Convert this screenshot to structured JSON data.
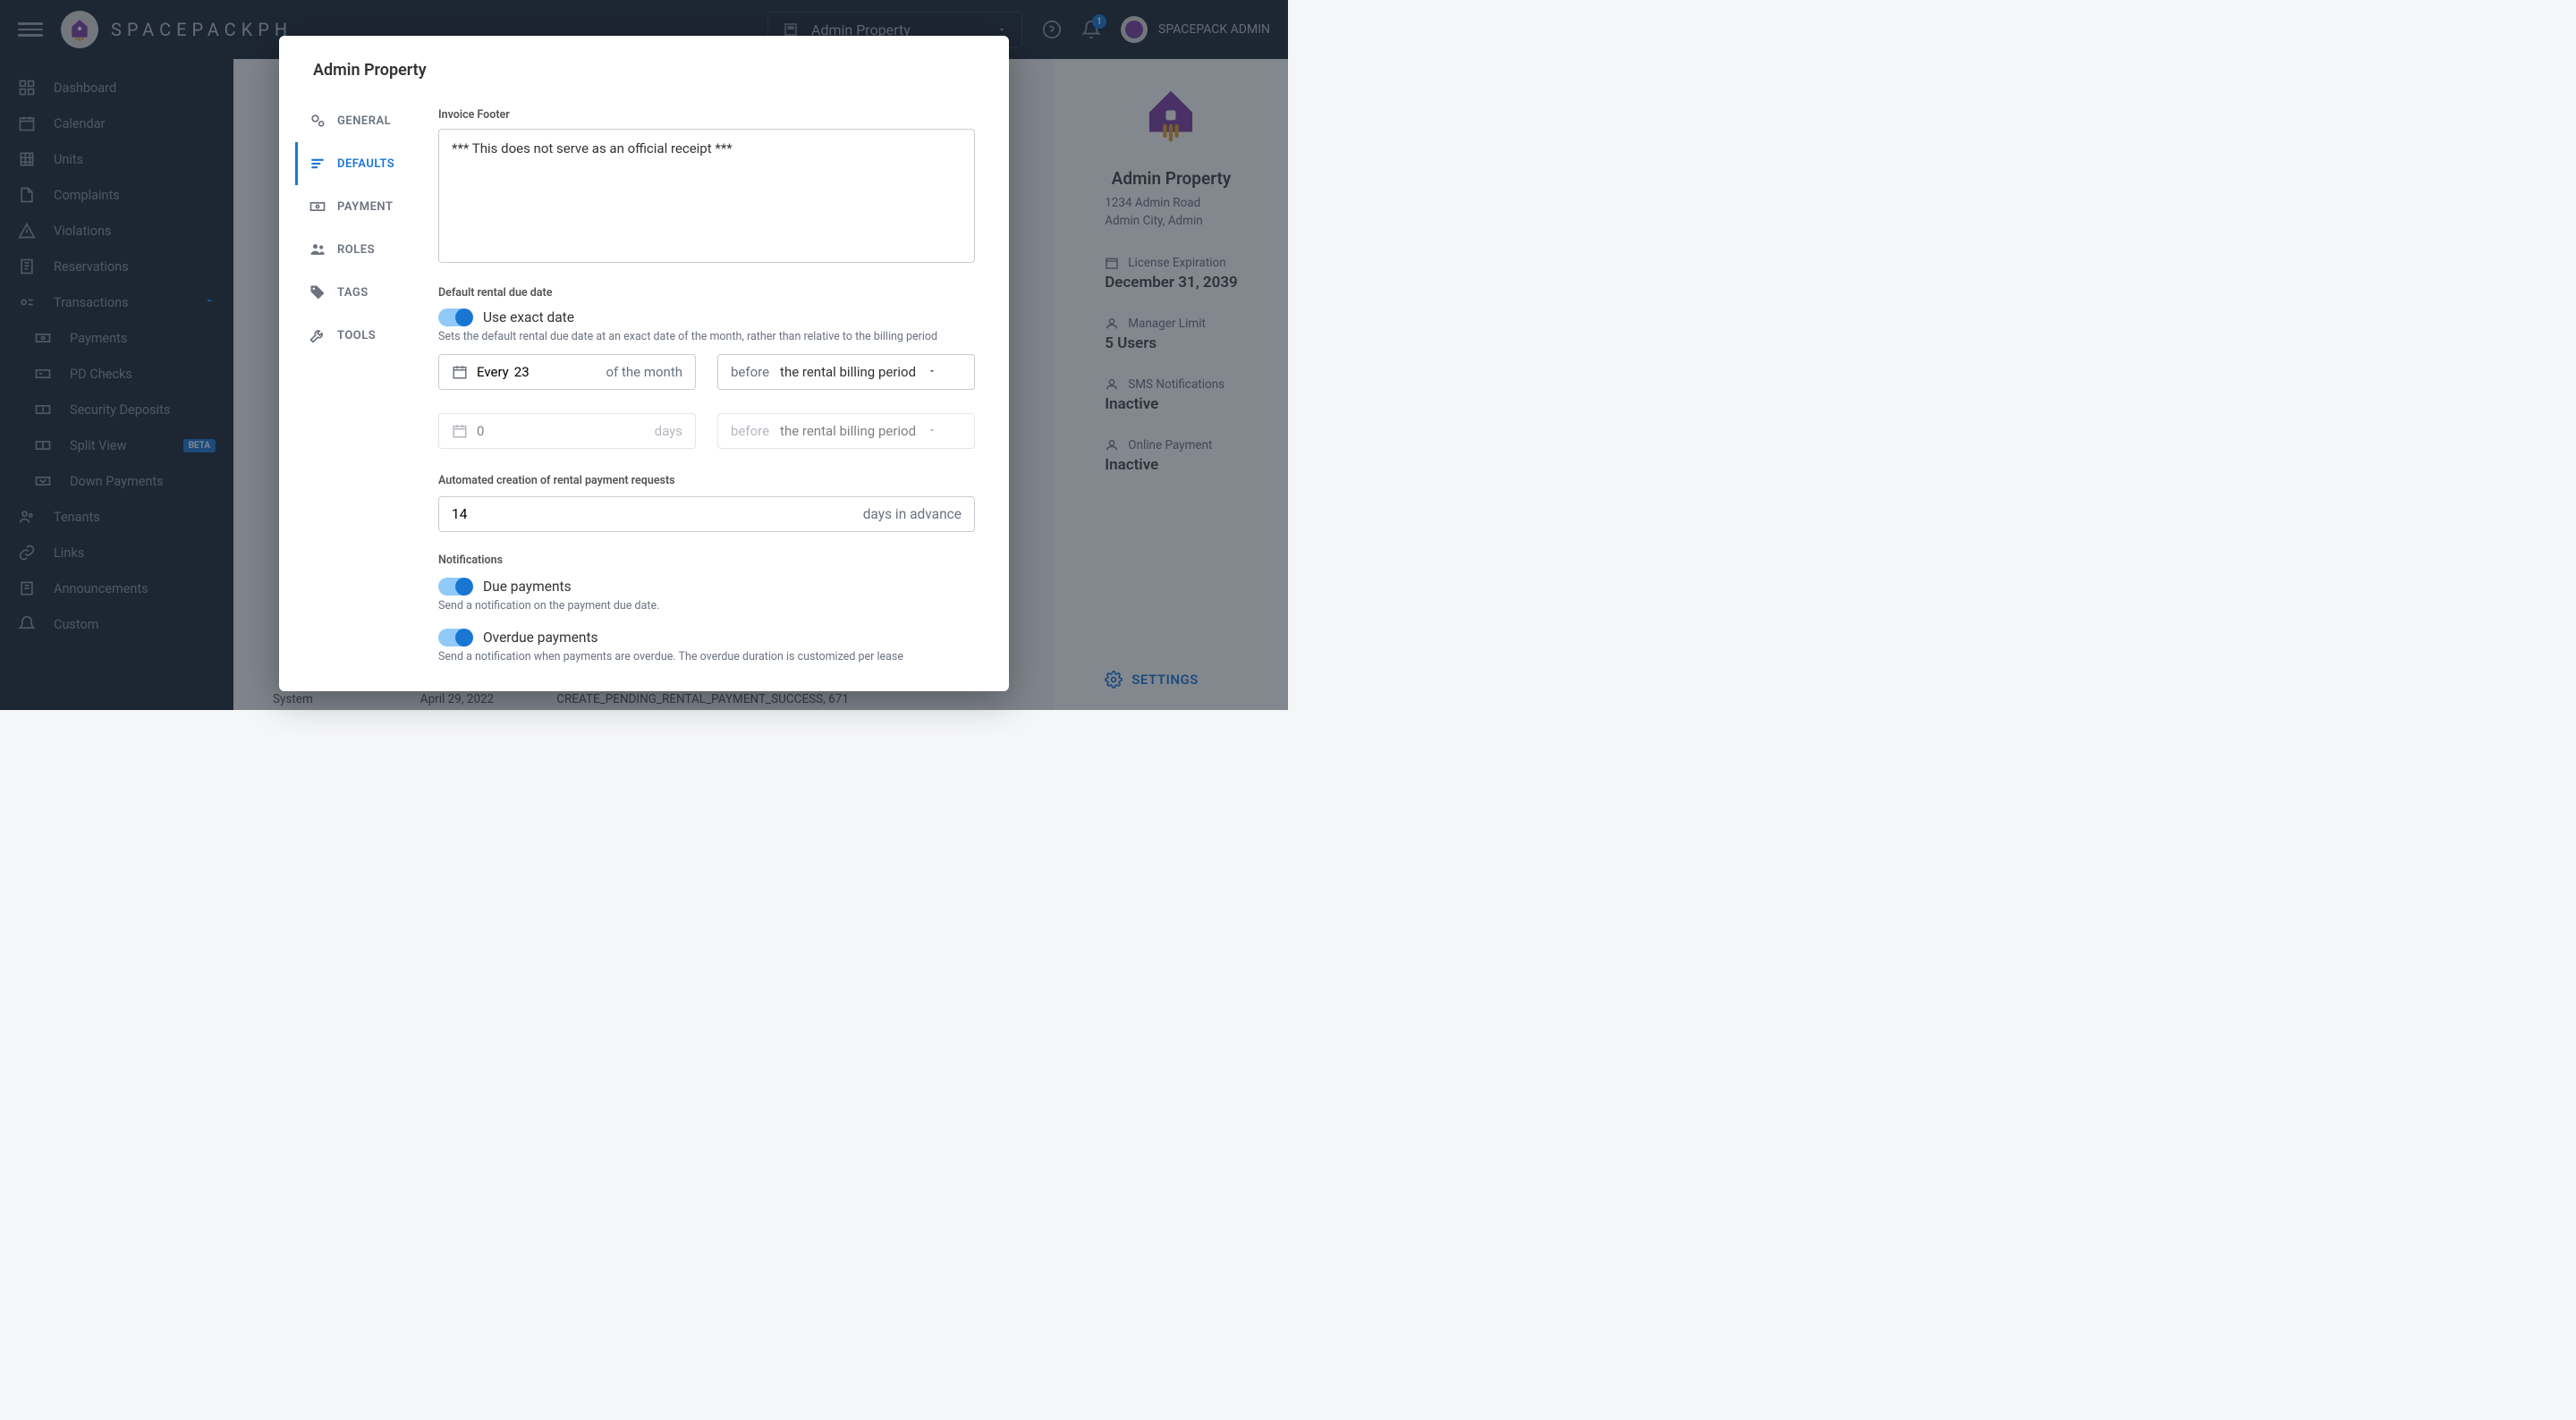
{
  "brand": "SPACEPACKPH",
  "header": {
    "propertySelector": "Admin Property",
    "notificationCount": "1",
    "username": "SPACEPACK ADMIN"
  },
  "sidebar": {
    "items": [
      {
        "label": "Dashboard",
        "icon": "dashboard"
      },
      {
        "label": "Calendar",
        "icon": "calendar"
      },
      {
        "label": "Units",
        "icon": "units"
      },
      {
        "label": "Complaints",
        "icon": "complaints"
      },
      {
        "label": "Violations",
        "icon": "violations"
      },
      {
        "label": "Reservations",
        "icon": "reservations"
      },
      {
        "label": "Transactions",
        "icon": "transactions",
        "expanded": true,
        "children": [
          {
            "label": "Payments"
          },
          {
            "label": "PD Checks"
          },
          {
            "label": "Security Deposits"
          },
          {
            "label": "Split View",
            "badge": "BETA"
          },
          {
            "label": "Down Payments"
          }
        ]
      },
      {
        "label": "Tenants",
        "icon": "tenants"
      },
      {
        "label": "Links",
        "icon": "links"
      },
      {
        "label": "Announcements",
        "icon": "announcements"
      },
      {
        "label": "Custom",
        "icon": "custom"
      }
    ]
  },
  "rightPanel": {
    "name": "Admin Property",
    "addr1": "1234 Admin Road",
    "addr2": "Admin City, Admin",
    "licenseLabel": "License Expiration",
    "licenseValue": "December 31, 2039",
    "managerLabel": "Manager Limit",
    "managerValue": "5 Users",
    "smsLabel": "SMS Notifications",
    "smsValue": "Inactive",
    "onlineLabel": "Online Payment",
    "onlineValue": "Inactive",
    "settingsLabel": "SETTINGS"
  },
  "bgRow": {
    "col1": "System",
    "col2": "April 29, 2022",
    "col3": "CREATE_PENDING_RENTAL_PAYMENT_SUCCESS, 671"
  },
  "modal": {
    "title": "Admin Property",
    "tabs": [
      {
        "label": "GENERAL"
      },
      {
        "label": "DEFAULTS",
        "active": true
      },
      {
        "label": "PAYMENT"
      },
      {
        "label": "ROLES"
      },
      {
        "label": "TAGS"
      },
      {
        "label": "TOOLS"
      }
    ],
    "invoiceFooterLabel": "Invoice Footer",
    "invoiceFooterValue": "*** This does not serve as an official receipt ***",
    "defaultDueLabel": "Default rental due date",
    "useExactLabel": "Use exact date",
    "useExactHint": "Sets the default rental due date at an exact date of the month, rather than relative to the billing period",
    "everyPrefix": "Every",
    "dateValue": "23",
    "ofMonth": "of the month",
    "beforeLabel": "before",
    "billingPeriod": "the rental billing period",
    "daysValue": "0",
    "daysLabel": "days",
    "autoLabel": "Automated creation of rental payment requests",
    "autoValue": "14",
    "autoSuffix": "days in advance",
    "notifLabel": "Notifications",
    "dueLabel": "Due payments",
    "dueHint": "Send a notification on the payment due date.",
    "overdueLabel": "Overdue payments",
    "overdueHint": "Send a notification when payments are overdue. The overdue duration is customized per lease"
  }
}
